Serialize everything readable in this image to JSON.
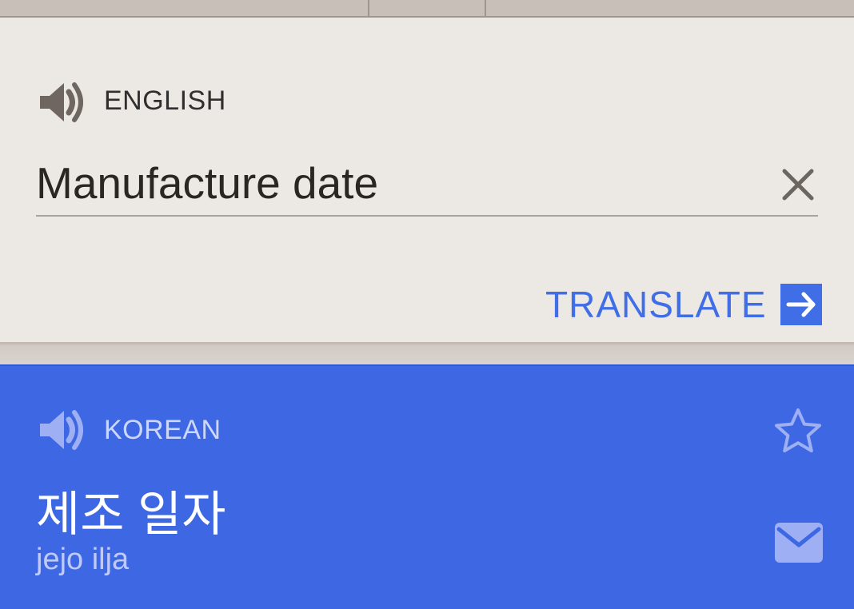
{
  "source": {
    "language_label": "ENGLISH",
    "input_value": "Manufacture date",
    "input_placeholder": "",
    "speaker_icon": "speaker-icon",
    "clear_icon": "close-icon"
  },
  "actions": {
    "translate_label": "TRANSLATE",
    "translate_icon": "arrow-right-icon"
  },
  "result": {
    "language_label": "KOREAN",
    "translation": "제조 일자",
    "transliteration": "jejo ilja",
    "speaker_icon": "speaker-icon",
    "star_icon": "star-outline-icon",
    "mail_icon": "mail-icon"
  },
  "colors": {
    "source_background": "#ece8e4",
    "accent_blue": "#3e67e3",
    "text_dark": "#2a2621",
    "translate_blue": "#3f6ee7"
  }
}
